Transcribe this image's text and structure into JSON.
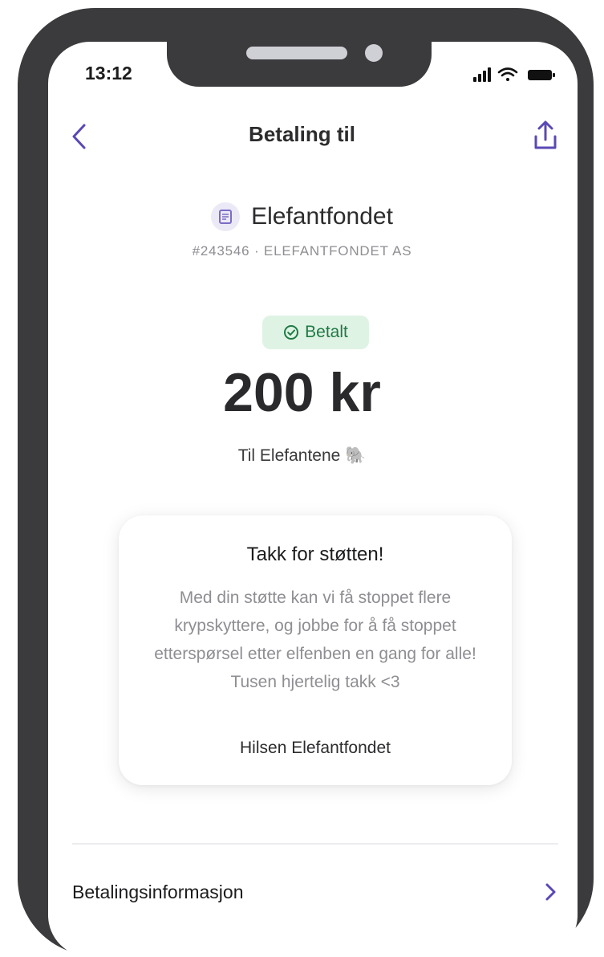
{
  "status_bar": {
    "time": "13:12"
  },
  "nav": {
    "title": "Betaling til",
    "back_icon": "chevron-left-icon",
    "share_icon": "share-icon"
  },
  "merchant": {
    "name": "Elefantfondet",
    "subtitle": "#243546 · ELEFANTFONDET AS",
    "icon": "receipt-icon"
  },
  "payment": {
    "status": "Betalt",
    "status_icon": "check-circle-icon",
    "amount": "200 kr",
    "message": "Til Elefantene 🐘"
  },
  "thank_you_card": {
    "title": "Takk for støtten!",
    "body": "Med din støtte kan vi få stoppet flere krypskyttere, og jobbe for å få stoppet etterspørsel etter elfenben en gang for alle! Tusen hjertelig takk <3",
    "signature": "Hilsen Elefantfondet"
  },
  "details_row": {
    "label": "Betalingsinformasjon",
    "chevron_icon": "chevron-right-icon"
  },
  "colors": {
    "accent": "#5b48b5",
    "paid_badge_bg": "#dff3e5",
    "paid_badge_text": "#1f7a43",
    "frame": "#3b3b3d"
  }
}
